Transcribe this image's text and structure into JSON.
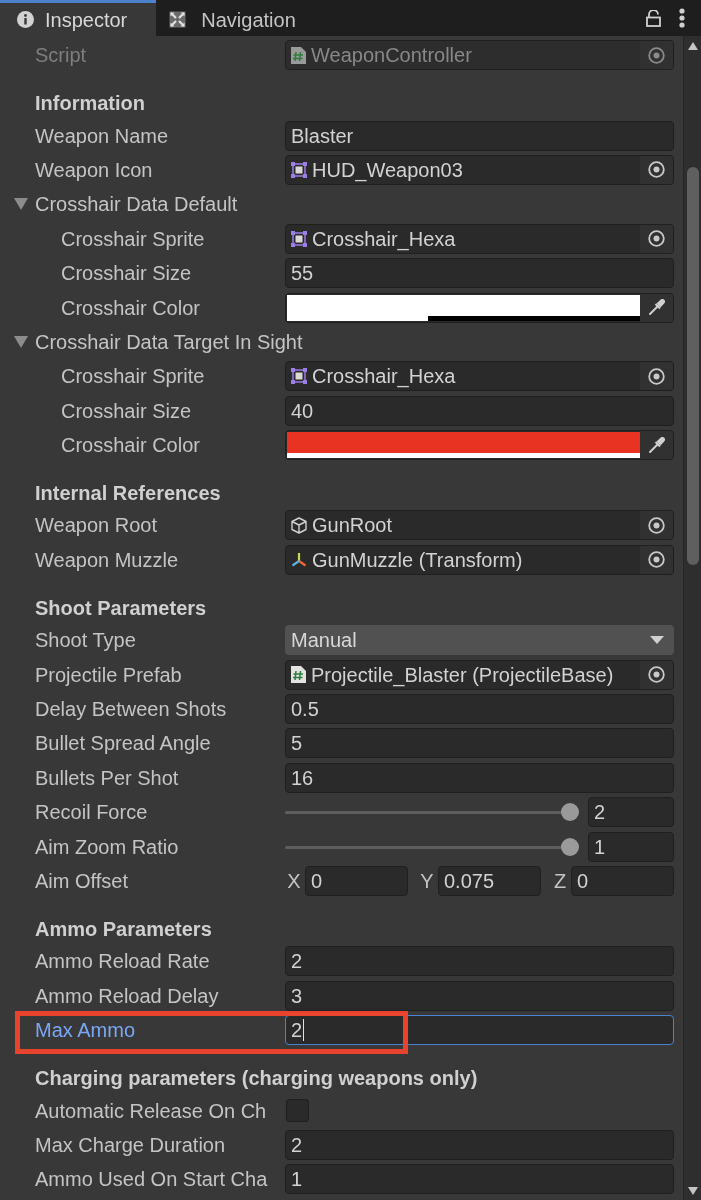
{
  "tabs": [
    {
      "label": "Inspector",
      "selected": true
    },
    {
      "label": "Navigation",
      "selected": false
    }
  ],
  "rows": [
    {
      "kind": "script",
      "label": "Script",
      "value": "WeaponController",
      "disabled": true
    },
    {
      "kind": "header",
      "label": "Information"
    },
    {
      "kind": "text",
      "label": "Weapon Name",
      "value": "Blaster"
    },
    {
      "kind": "sprite",
      "label": "Weapon Icon",
      "value": "HUD_Weapon03"
    },
    {
      "kind": "foldout",
      "label": "Crosshair Data Default",
      "expanded": true,
      "children": [
        {
          "kind": "sprite",
          "label": "Crosshair Sprite",
          "value": "Crosshair_Hexa"
        },
        {
          "kind": "text",
          "label": "Crosshair Size",
          "value": "55"
        },
        {
          "kind": "color",
          "label": "Crosshair Color",
          "color": "#ffffff",
          "level": 0.4
        }
      ]
    },
    {
      "kind": "foldout",
      "label": "Crosshair Data Target In Sight",
      "expanded": true,
      "children": [
        {
          "kind": "sprite",
          "label": "Crosshair Sprite",
          "value": "Crosshair_Hexa"
        },
        {
          "kind": "text",
          "label": "Crosshair Size",
          "value": "40"
        },
        {
          "kind": "color",
          "label": "Crosshair Color",
          "color": "#e83323",
          "level": 1
        }
      ]
    },
    {
      "kind": "header",
      "label": "Internal References"
    },
    {
      "kind": "gameobject",
      "label": "Weapon Root",
      "value": "GunRoot"
    },
    {
      "kind": "transform",
      "label": "Weapon Muzzle",
      "value": "GunMuzzle (Transform)"
    },
    {
      "kind": "header",
      "label": "Shoot Parameters"
    },
    {
      "kind": "dropdown",
      "label": "Shoot Type",
      "value": "Manual"
    },
    {
      "kind": "script",
      "label": "Projectile Prefab",
      "value": "Projectile_Blaster (ProjectileBase)"
    },
    {
      "kind": "text",
      "label": "Delay Between Shots",
      "value": "0.5"
    },
    {
      "kind": "text",
      "label": "Bullet Spread Angle",
      "value": "5"
    },
    {
      "kind": "text",
      "label": "Bullets Per Shot",
      "value": "16"
    },
    {
      "kind": "slider",
      "label": "Recoil Force",
      "level": 1,
      "value": "2"
    },
    {
      "kind": "slider",
      "label": "Aim Zoom Ratio",
      "level": 1,
      "value": "1"
    },
    {
      "kind": "vector3",
      "label": "Aim Offset",
      "components": [
        {
          "axis": "X",
          "value": "0"
        },
        {
          "axis": "Y",
          "value": "0.075"
        },
        {
          "axis": "Z",
          "value": "0"
        }
      ]
    },
    {
      "kind": "header",
      "label": "Ammo Parameters"
    },
    {
      "kind": "text",
      "label": "Ammo Reload Rate",
      "value": "2"
    },
    {
      "kind": "text",
      "label": "Ammo Reload Delay",
      "value": "3"
    },
    {
      "kind": "text",
      "label": "Max Ammo",
      "value": "2",
      "focused": true,
      "highlighted": true
    },
    {
      "kind": "header",
      "label": "Charging parameters (charging weapons only)"
    },
    {
      "kind": "checkbox",
      "label": "Automatic Release On Ch",
      "checked": false
    },
    {
      "kind": "text",
      "label": "Max Charge Duration",
      "value": "2"
    },
    {
      "kind": "text",
      "label": "Ammo Used On Start Cha",
      "value": "1"
    }
  ]
}
